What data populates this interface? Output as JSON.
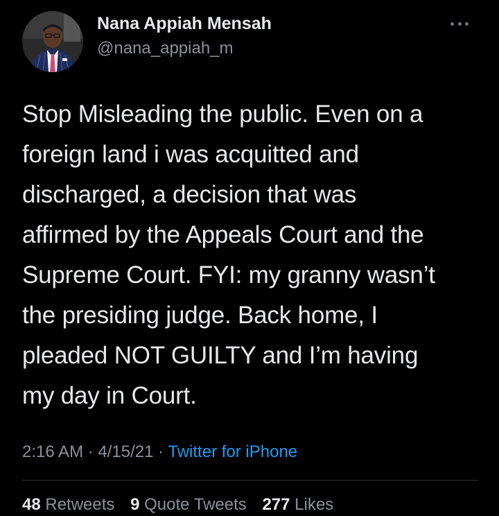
{
  "author": {
    "name": "Nana Appiah Mensah",
    "handle": "@nana_appiah_m"
  },
  "tweet": {
    "lines": [
      "Stop Misleading the public. Even on a",
      "foreign land i was acquitted and",
      "discharged, a decision that was",
      "affirmed by the Appeals Court and the",
      "Supreme Court. FYI: my granny wasn’t",
      "the presiding judge. Back home, I",
      "pleaded NOT GUILTY and I’m having",
      "my day in Court."
    ],
    "time": "2:16 AM",
    "separator": "·",
    "date": "4/15/21",
    "source": "Twitter for iPhone"
  },
  "stats": {
    "retweets_count": "48",
    "retweets_label": "Retweets",
    "quotes_count": "9",
    "quotes_label": "Quote Tweets",
    "likes_count": "277",
    "likes_label": "Likes"
  },
  "icons": {
    "more": "more-horizontal-icon",
    "avatar": "profile-photo"
  },
  "colors": {
    "background": "#000000",
    "text": "#e7e9ea",
    "secondary": "#8b9299",
    "link": "#1d9bf0",
    "divider": "#2f3336"
  }
}
